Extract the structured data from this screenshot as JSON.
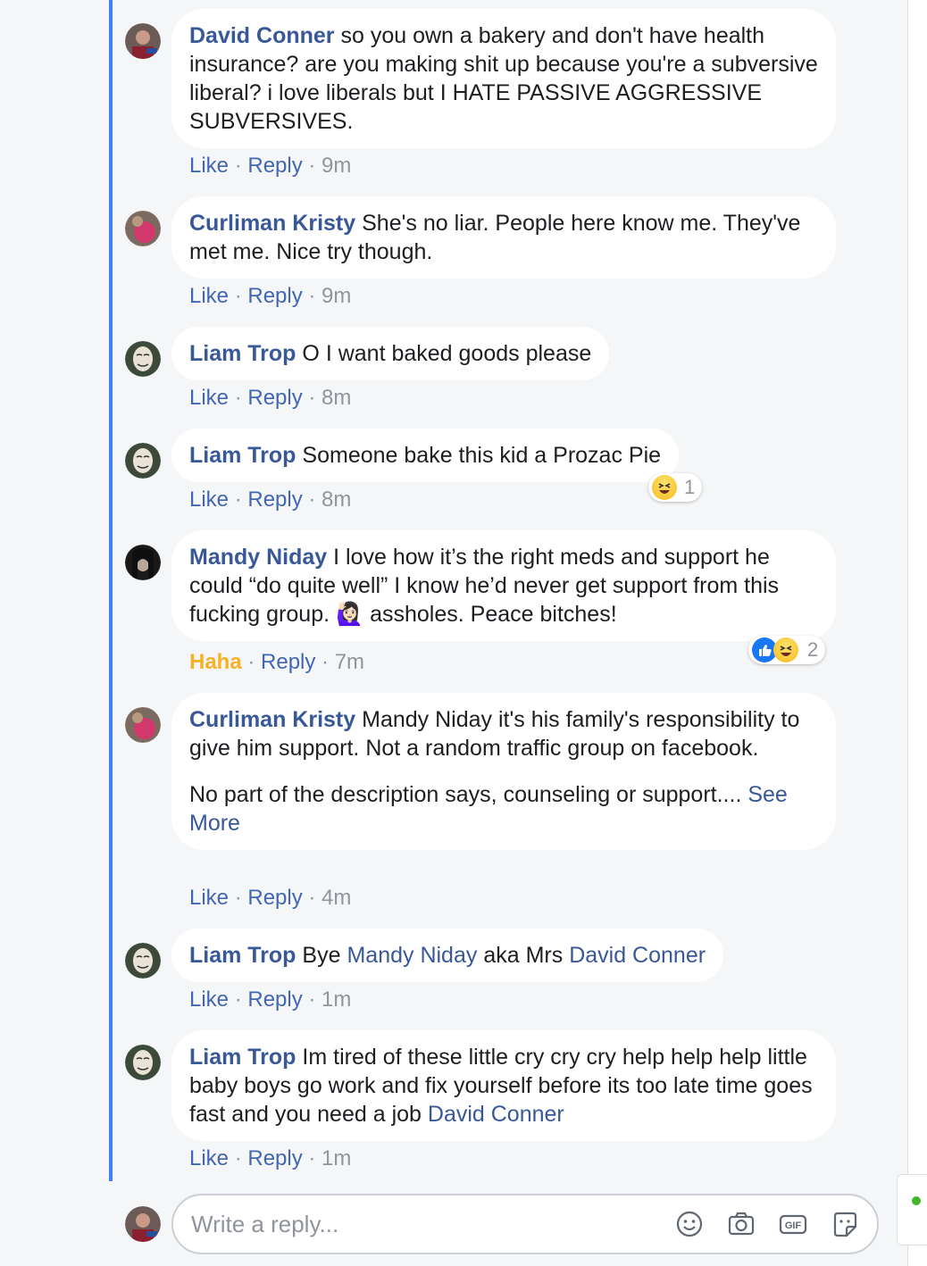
{
  "comments": [
    {
      "author": "David Conner",
      "text": "so you own a bakery and don't have health insurance? are you making shit up because you're a subversive liberal? i love liberals but I HATE PASSIVE AGGRESSIVE SUBVERSIVES.",
      "like": "Like",
      "reply": "Reply",
      "time": "9m"
    },
    {
      "author": "Curliman Kristy",
      "text": "She's no liar. People here know me. They've met me. Nice try though.",
      "like": "Like",
      "reply": "Reply",
      "time": "9m"
    },
    {
      "author": "Liam Trop",
      "text": "O I want baked goods please",
      "like": "Like",
      "reply": "Reply",
      "time": "8m"
    },
    {
      "author": "Liam Trop",
      "text": "Someone bake this kid a Prozac Pie",
      "like": "Like",
      "reply": "Reply",
      "time": "8m",
      "reactions": {
        "count": "1",
        "types": [
          "haha-icon"
        ]
      }
    },
    {
      "author": "Mandy Niday",
      "text_before": "I love how it’s the right meds and support he could “do quite well” I know he’d never get support from this fucking group.",
      "emoji": "🙋🏻‍♀️",
      "text_after": "assholes. Peace bitches!",
      "like": "Haha",
      "reply": "Reply",
      "time": "7m",
      "reactions": {
        "count": "2",
        "types": [
          "like-icon",
          "haha-icon"
        ]
      }
    },
    {
      "author": "Curliman Kristy",
      "para1": "Mandy Niday it's his family's responsibility to give him support. Not a random traffic group on facebook.",
      "para2": "No part of the description says, counseling or support....",
      "see_more": "See More",
      "like": "Like",
      "reply": "Reply",
      "time": "4m"
    },
    {
      "author": "Liam Trop",
      "text_a": "Bye",
      "mention1": "Mandy Niday",
      "text_b": "aka Mrs",
      "mention2": "David Conner",
      "like": "Like",
      "reply": "Reply",
      "time": "1m"
    },
    {
      "author": "Liam Trop",
      "text": "Im tired of these little cry cry cry help help help little baby boys go work and fix yourself before its too late time goes fast and you need a job",
      "mention": "David Conner",
      "like": "Like",
      "reply": "Reply",
      "time": "1m"
    }
  ],
  "reply_box": {
    "placeholder": "Write a reply...",
    "icons": [
      "emoji-icon",
      "camera-icon",
      "gif-icon",
      "sticker-icon"
    ]
  },
  "colors": {
    "name": "#385898",
    "thread_line": "#4080ff",
    "haha_action": "#f7b125",
    "online": "#42b72a"
  }
}
